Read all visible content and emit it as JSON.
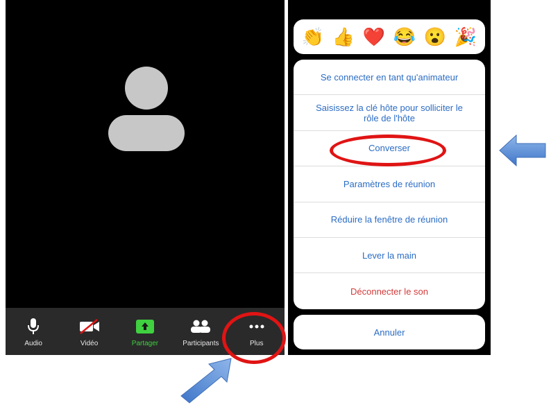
{
  "toolbar": {
    "items": [
      {
        "label": "Audio"
      },
      {
        "label": "Vidéo"
      },
      {
        "label": "Partager"
      },
      {
        "label": "Participants"
      },
      {
        "label": "Plus"
      }
    ]
  },
  "reactions": [
    "👏",
    "👍",
    "❤️",
    "😂",
    "😮",
    "🎉"
  ],
  "menu": {
    "items": [
      {
        "label": "Se connecter en tant qu'animateur"
      },
      {
        "label": "Saisissez la clé hôte pour solliciter le rôle de l'hôte"
      },
      {
        "label": "Converser"
      },
      {
        "label": "Paramètres de réunion"
      },
      {
        "label": "Réduire la fenêtre de réunion"
      },
      {
        "label": "Lever la main"
      },
      {
        "label": "Déconnecter le son"
      }
    ],
    "cancel_label": "Annuler"
  },
  "colors": {
    "link_blue": "#2b6cc4",
    "danger_red": "#d23b3b",
    "annotation_red": "#e01414",
    "arrow_blue": "#5b8fd6",
    "share_green": "#3fd13f"
  }
}
